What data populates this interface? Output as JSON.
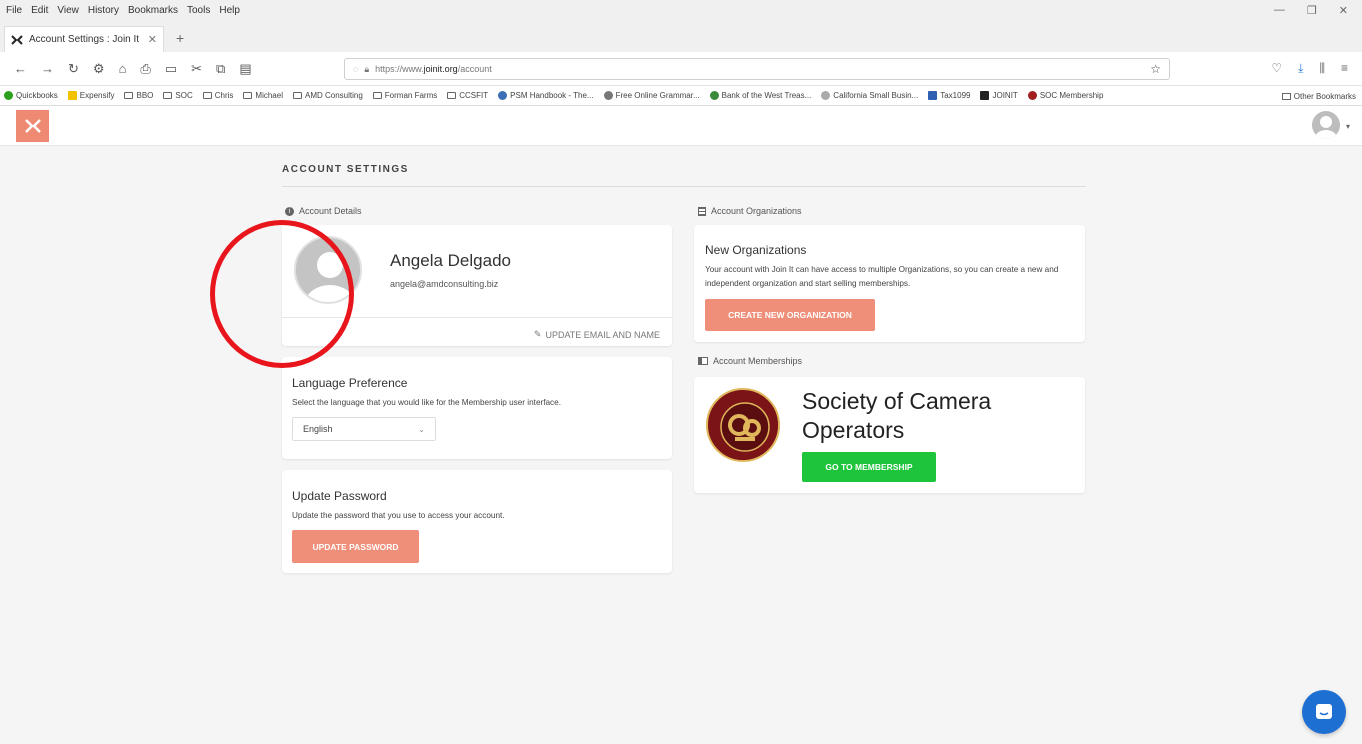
{
  "browser": {
    "menu": [
      "File",
      "Edit",
      "View",
      "History",
      "Bookmarks",
      "Tools",
      "Help"
    ],
    "tab_title": "Account Settings : Join It",
    "url_prefix": "https://www.",
    "url_domain": "joinit.org",
    "url_path": "/account",
    "bookmarks": [
      "Quickbooks",
      "Expensify",
      "BBO",
      "SOC",
      "Chris",
      "Michael",
      "AMD Consulting",
      "Forman Farms",
      "CCSFIT",
      "PSM Handbook - The...",
      "Free Online Grammar...",
      "Bank of the West Treas...",
      "California Small Busin...",
      "Tax1099",
      "JOINIT",
      "SOC Membership"
    ],
    "other_bookmarks": "Other Bookmarks"
  },
  "page": {
    "title": "ACCOUNT SETTINGS"
  },
  "account_details": {
    "section_label": "Account Details",
    "name": "Angela Delgado",
    "email": "angela@amdconsulting.biz",
    "update_link": "UPDATE EMAIL AND NAME"
  },
  "language": {
    "heading": "Language Preference",
    "description": "Select the language that you would like for the Membership user interface.",
    "selected": "English"
  },
  "password": {
    "heading": "Update Password",
    "description": "Update the password that you use to access your account.",
    "button": "UPDATE PASSWORD"
  },
  "organizations": {
    "section_label": "Account Organizations",
    "heading": "New Organizations",
    "description": "Your account with Join It can have access to multiple Organizations, so you can create a new and independent organization and start selling memberships.",
    "button": "CREATE NEW ORGANIZATION"
  },
  "memberships": {
    "section_label": "Account Memberships",
    "org_name": "Society of Camera Operators",
    "button": "GO TO MEMBERSHIP"
  },
  "colors": {
    "accent": "#ef8f79",
    "green": "#1ec53b",
    "annotation": "#e8161c",
    "chat": "#1d6fd2"
  }
}
